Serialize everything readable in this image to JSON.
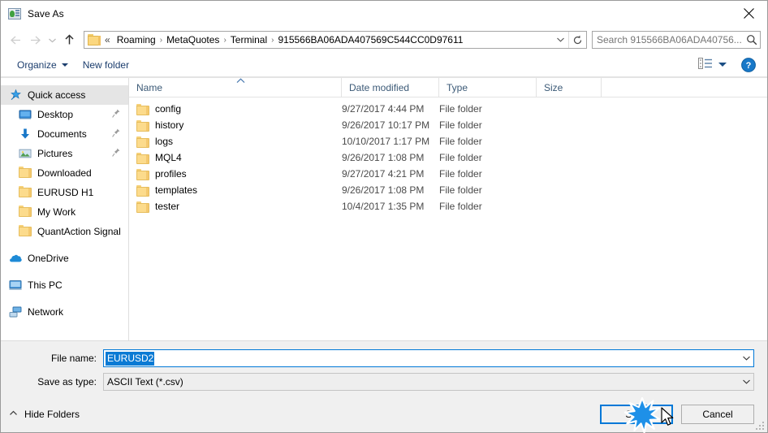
{
  "window": {
    "title": "Save As",
    "title_icon": "metatrader-icon",
    "close_label": "✕"
  },
  "nav": {
    "back": "back-arrow",
    "forward": "forward-arrow",
    "recent": "recent-locations-chevron",
    "up": "up-arrow"
  },
  "address": {
    "folder_icon": "folder-icon",
    "overflow": "«",
    "crumbs": [
      "Roaming",
      "MetaQuotes",
      "Terminal",
      "915566BA06ADA407569C544CC0D97611"
    ],
    "separator": "›",
    "dropdown_icon": "chevron-down-icon",
    "refresh_icon": "refresh-icon"
  },
  "search": {
    "placeholder": "Search 915566BA06ADA40756...",
    "value": "",
    "icon": "search-icon"
  },
  "toolbar": {
    "organize_label": "Organize",
    "new_folder_label": "New folder",
    "view_icon": "view-options-icon",
    "help_icon": "help-icon",
    "help_label": "?"
  },
  "sidebar": {
    "items": [
      {
        "label": "Quick access",
        "icon": "star-pin-icon",
        "level": 0,
        "selected": true,
        "pinned": false
      },
      {
        "label": "Desktop",
        "icon": "desktop-icon",
        "level": 1,
        "selected": false,
        "pinned": true
      },
      {
        "label": "Documents",
        "icon": "documents-icon",
        "level": 1,
        "selected": false,
        "pinned": true
      },
      {
        "label": "Pictures",
        "icon": "pictures-icon",
        "level": 1,
        "selected": false,
        "pinned": true
      },
      {
        "label": "Downloaded",
        "icon": "folder-icon",
        "level": 1,
        "selected": false,
        "pinned": false
      },
      {
        "label": "EURUSD H1",
        "icon": "folder-icon",
        "level": 1,
        "selected": false,
        "pinned": false
      },
      {
        "label": "My Work",
        "icon": "folder-icon",
        "level": 1,
        "selected": false,
        "pinned": false
      },
      {
        "label": "QuantAction Signal",
        "icon": "folder-icon",
        "level": 1,
        "selected": false,
        "pinned": false
      },
      {
        "label": "OneDrive",
        "icon": "onedrive-icon",
        "level": 0,
        "selected": false,
        "pinned": false,
        "gap_before": true
      },
      {
        "label": "This PC",
        "icon": "this-pc-icon",
        "level": 0,
        "selected": false,
        "pinned": false,
        "gap_before": true
      },
      {
        "label": "Network",
        "icon": "network-icon",
        "level": 0,
        "selected": false,
        "pinned": false,
        "gap_before": true
      }
    ]
  },
  "filelist": {
    "columns": [
      "Name",
      "Date modified",
      "Type",
      "Size"
    ],
    "sort_column": "Name",
    "sort_direction": "ascending",
    "rows": [
      {
        "name": "config",
        "date": "9/27/2017 4:44 PM",
        "type": "File folder",
        "size": ""
      },
      {
        "name": "history",
        "date": "9/26/2017 10:17 PM",
        "type": "File folder",
        "size": ""
      },
      {
        "name": "logs",
        "date": "10/10/2017 1:17 PM",
        "type": "File folder",
        "size": ""
      },
      {
        "name": "MQL4",
        "date": "9/26/2017 1:08 PM",
        "type": "File folder",
        "size": ""
      },
      {
        "name": "profiles",
        "date": "9/27/2017 4:21 PM",
        "type": "File folder",
        "size": ""
      },
      {
        "name": "templates",
        "date": "9/26/2017 1:08 PM",
        "type": "File folder",
        "size": ""
      },
      {
        "name": "tester",
        "date": "10/4/2017 1:35 PM",
        "type": "File folder",
        "size": ""
      }
    ]
  },
  "form": {
    "filename_label": "File name:",
    "filename_value": "EURUSD2",
    "filetype_label": "Save as type:",
    "filetype_value": "ASCII Text (*.csv)"
  },
  "footer": {
    "hide_folders_label": "Hide Folders",
    "hide_folders_icon": "chevron-up-icon",
    "save_label": "Save",
    "cancel_label": "Cancel",
    "resize_grip": "resize-grip"
  },
  "overlay": {
    "click_burst": "click-burst-indicator",
    "cursor": "mouse-pointer-cursor"
  },
  "colors": {
    "accent": "#0078d7",
    "selection": "#0a7ad4",
    "column_header_text": "#3c5a77",
    "toolbar_link": "#1b3d6d",
    "folder_yellow": "#fcdb8c",
    "panel_bg": "#f0f0f0"
  }
}
